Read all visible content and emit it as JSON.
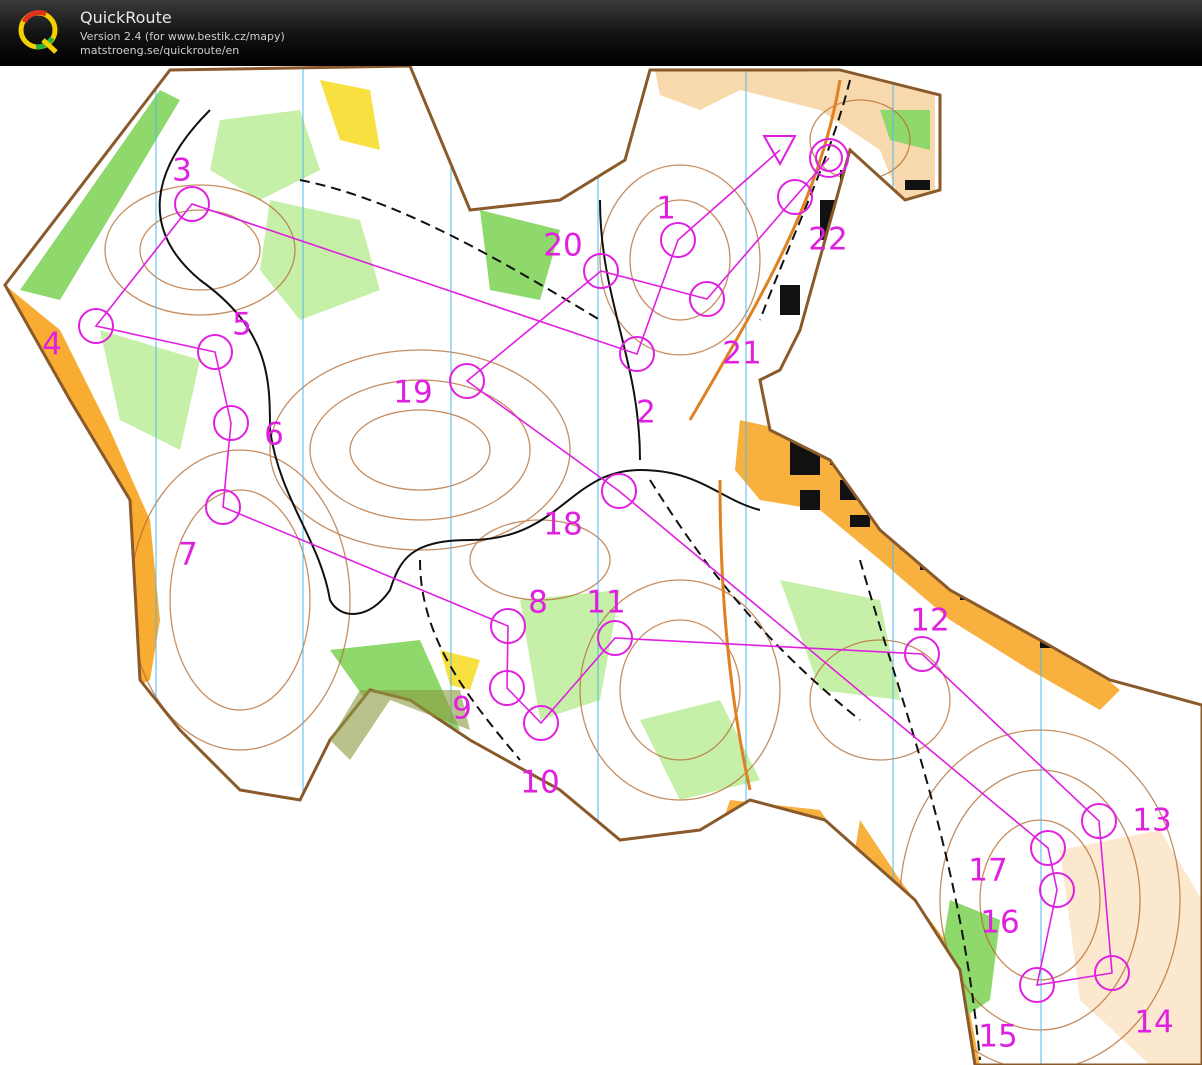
{
  "app": {
    "title": "QuickRoute",
    "version": "Version 2.4  (for www.bestik.cz/mapy)",
    "website": "matstroeng.se/quickroute/en",
    "logo_letter": "Q"
  },
  "colors": {
    "course": "#e020e0",
    "contour": "#b4682c",
    "open_land": "#f7a31c",
    "forest_green": "#8fd86c",
    "light_green": "#c6f0a8",
    "track": "#111111",
    "meridian": "#4fb8ec",
    "yellow": "#f8e040"
  },
  "course": {
    "start_label": "start triangle",
    "finish_label": "finish double circle",
    "controls": [
      {
        "label": "1"
      },
      {
        "label": "2"
      },
      {
        "label": "3"
      },
      {
        "label": "4"
      },
      {
        "label": "5"
      },
      {
        "label": "6"
      },
      {
        "label": "7"
      },
      {
        "label": "8"
      },
      {
        "label": "9"
      },
      {
        "label": "10"
      },
      {
        "label": "11"
      },
      {
        "label": "12"
      },
      {
        "label": "13"
      },
      {
        "label": "14"
      },
      {
        "label": "15"
      },
      {
        "label": "16"
      },
      {
        "label": "17"
      },
      {
        "label": "18"
      },
      {
        "label": "19"
      },
      {
        "label": "20"
      },
      {
        "label": "21"
      },
      {
        "label": "22"
      }
    ]
  }
}
